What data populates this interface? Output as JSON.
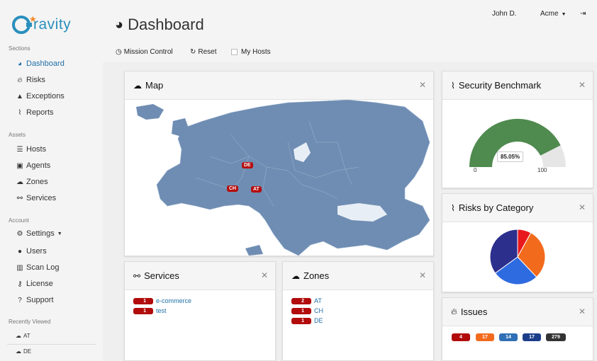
{
  "brand": {
    "name": "ravity"
  },
  "sidebar": {
    "sections_label": "Sections",
    "assets_label": "Assets",
    "account_label": "Account",
    "recent_label": "Recently Viewed",
    "sections": [
      {
        "label": "Dashboard",
        "icon": "dashboard-icon"
      },
      {
        "label": "Risks",
        "icon": "fire-icon"
      },
      {
        "label": "Exceptions",
        "icon": "warning-icon"
      },
      {
        "label": "Reports",
        "icon": "chart-icon"
      }
    ],
    "assets": [
      {
        "label": "Hosts",
        "icon": "server-icon"
      },
      {
        "label": "Agents",
        "icon": "agent-icon"
      },
      {
        "label": "Zones",
        "icon": "cloud-icon"
      },
      {
        "label": "Services",
        "icon": "sitemap-icon"
      }
    ],
    "account": [
      {
        "label": "Settings",
        "icon": "gear-icon"
      },
      {
        "label": "Users",
        "icon": "user-icon"
      },
      {
        "label": "Scan Log",
        "icon": "barcode-icon"
      },
      {
        "label": "License",
        "icon": "key-icon"
      },
      {
        "label": "Support",
        "icon": "help-icon"
      }
    ],
    "recent": [
      {
        "label": "AT",
        "icon": "cloud-icon"
      },
      {
        "label": "DE",
        "icon": "cloud-icon"
      }
    ]
  },
  "header": {
    "title": "Dashboard",
    "user": "John D.",
    "org": "Acme"
  },
  "toolbar": {
    "mission_control": "Mission Control",
    "reset": "Reset",
    "my_hosts": "My Hosts"
  },
  "map_card": {
    "title": "Map",
    "pins": [
      "DE",
      "CH",
      "AT"
    ]
  },
  "services_card": {
    "title": "Services",
    "rows": [
      {
        "count": "1",
        "label": "e-commerce"
      },
      {
        "count": "1",
        "label": "test"
      }
    ]
  },
  "zones_card": {
    "title": "Zones",
    "rows": [
      {
        "count": "2",
        "label": "AT"
      },
      {
        "count": "1",
        "label": "CH"
      },
      {
        "count": "1",
        "label": "DE"
      }
    ]
  },
  "benchmark_card": {
    "title": "Security Benchmark",
    "value_label": "85.05%",
    "value": 85.05,
    "min_label": "0",
    "max_label": "100",
    "color_fill": "#4f8a4f",
    "color_track": "#e6e6e6"
  },
  "risk_card": {
    "title": "Risks by Category"
  },
  "chart_data": {
    "type": "pie",
    "title": "Risks by Category",
    "slices": [
      {
        "value": 8,
        "color": "#e8181c"
      },
      {
        "value": 30,
        "color": "#f26b1d"
      },
      {
        "value": 27,
        "color": "#2f6be0"
      },
      {
        "value": 35,
        "color": "#2c2f8c"
      }
    ]
  },
  "issues_card": {
    "title": "Issues",
    "badges": [
      {
        "label": "4",
        "color": "#b10b0b"
      },
      {
        "label": "17",
        "color": "#f26b1d"
      },
      {
        "label": "14",
        "color": "#2e6fb5"
      },
      {
        "label": "17",
        "color": "#1c3d8a"
      },
      {
        "label": "279",
        "color": "#333333"
      }
    ]
  },
  "colors": {
    "accent": "#1f6fa8",
    "danger": "#b10b0b",
    "map_land": "#6f8db3"
  }
}
